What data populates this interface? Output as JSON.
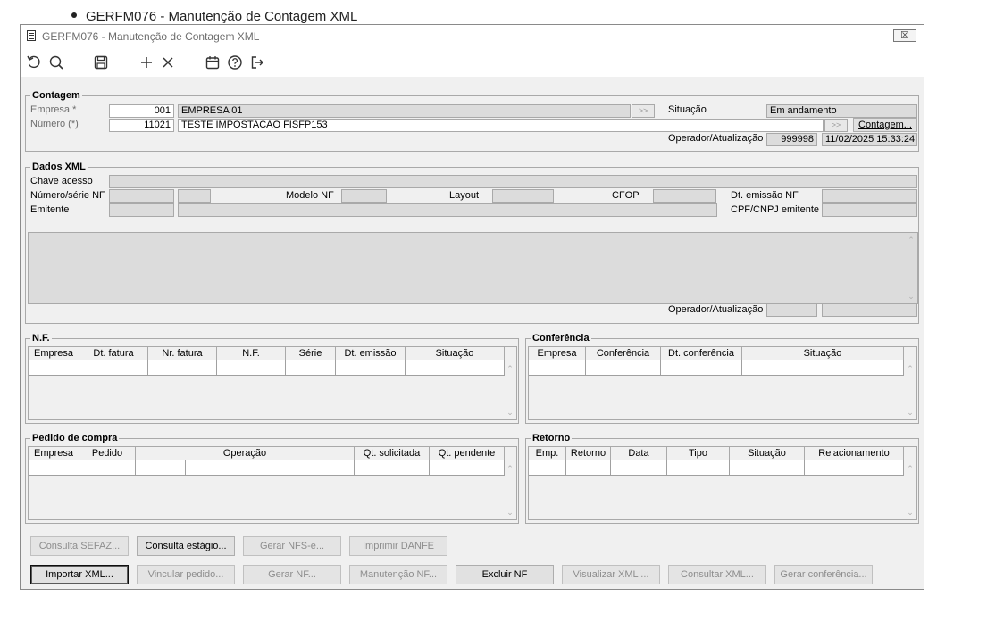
{
  "page_bullet": "GERFM076 - Manutenção de Contagem XML",
  "window": {
    "title": "GERFM076 - Manutenção de Contagem XML",
    "close_label": "☒"
  },
  "toolbar": {
    "icons": [
      "undo-icon",
      "search-icon",
      "save-icon",
      "add-icon",
      "delete-icon",
      "calendar-icon",
      "help-icon",
      "exit-icon"
    ]
  },
  "contagem": {
    "title": "Contagem",
    "empresa_label": "Empresa *",
    "empresa_code": "001",
    "empresa_name": "EMPRESA 01",
    "numero_label": "Número (*)",
    "numero_value": "11021",
    "descricao": "TESTE IMPOSTACAO FISFP153",
    "situacao_label": "Situação",
    "situacao_value": "Em andamento",
    "contagem_button": "Contagem...",
    "operador_label": "Operador/Atualização",
    "operador_value": "999998",
    "atualizacao_value": "11/02/2025 15:33:24"
  },
  "dados_xml": {
    "title": "Dados XML",
    "chave_label": "Chave acesso",
    "numero_serie_label": "Número/série NF",
    "modelo_label": "Modelo NF",
    "layout_label": "Layout",
    "cfop_label": "CFOP",
    "dt_emissao_label": "Dt. emissão NF",
    "emitente_label": "Emitente",
    "cpf_cnpj_label": "CPF/CNPJ emitente",
    "operador_label": "Operador/Atualização"
  },
  "nf": {
    "title": "N.F.",
    "columns": [
      "Empresa",
      "Dt. fatura",
      "Nr. fatura",
      "N.F.",
      "Série",
      "Dt. emissão",
      "Situação"
    ]
  },
  "conferencia": {
    "title": "Conferência",
    "columns": [
      "Empresa",
      "Conferência",
      "Dt. conferência",
      "Situação"
    ]
  },
  "pedido": {
    "title": "Pedido de compra",
    "columns": [
      "Empresa",
      "Pedido",
      "Operação",
      "Qt. solicitada",
      "Qt. pendente"
    ]
  },
  "retorno": {
    "title": "Retorno",
    "columns": [
      "Emp.",
      "Retorno",
      "Data",
      "Tipo",
      "Situação",
      "Relacionamento"
    ]
  },
  "buttons": {
    "consulta_sefaz": "Consulta SEFAZ...",
    "consulta_estagio": "Consulta estágio...",
    "gerar_nfse": "Gerar NFS-e...",
    "imprimir_danfe": "Imprimir DANFE",
    "importar_xml": "Importar XML...",
    "vincular_pedido": "Vincular pedido...",
    "gerar_nf": "Gerar NF...",
    "manutencao_nf": "Manutenção NF...",
    "excluir_nf": "Excluir NF",
    "visualizar_xml": "Visualizar XML ...",
    "consultar_xml": "Consultar XML...",
    "gerar_conferencia": "Gerar conferência..."
  }
}
